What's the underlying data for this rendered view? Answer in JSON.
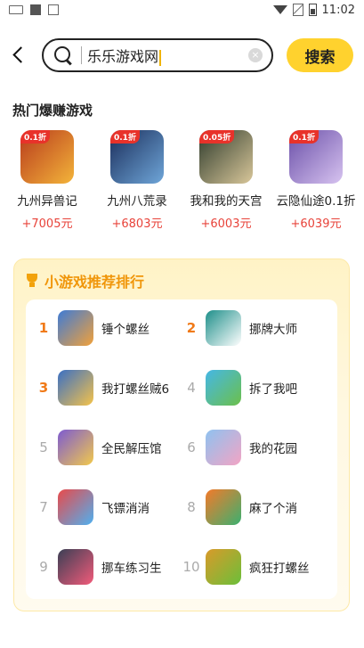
{
  "status_bar": {
    "time": "11:02"
  },
  "search": {
    "query": "乐乐游戏网",
    "clear_glyph": "×",
    "button_label": "搜索"
  },
  "hot": {
    "title": "热门爆赚游戏",
    "items": [
      {
        "name": "九州异兽记",
        "reward": "+7005元",
        "discount": "0.1折",
        "colors": [
          "#b83a1c",
          "#f3b43a"
        ]
      },
      {
        "name": "九州八荒录",
        "reward": "+6803元",
        "discount": "0.1折",
        "colors": [
          "#1a2d5a",
          "#6fa6d9"
        ]
      },
      {
        "name": "我和我的天宫",
        "reward": "+6003元",
        "discount": "0.05折",
        "colors": [
          "#2e3b2c",
          "#d9c79a"
        ]
      },
      {
        "name": "云隐仙途0.1折",
        "reward": "+6039元",
        "discount": "0.1折",
        "colors": [
          "#6a4fa8",
          "#d7c3f0"
        ]
      }
    ]
  },
  "ranking": {
    "title": "小游戏推荐排行",
    "items": [
      {
        "rank": "1",
        "name": "锤个螺丝",
        "colors": [
          "#3e7bd6",
          "#f2a13a"
        ]
      },
      {
        "rank": "2",
        "name": "挪牌大师",
        "colors": [
          "#1e8f8a",
          "#ffffff"
        ]
      },
      {
        "rank": "3",
        "name": "我打螺丝贼6",
        "colors": [
          "#3a6fc4",
          "#f5c34a"
        ]
      },
      {
        "rank": "4",
        "name": "拆了我吧",
        "colors": [
          "#45b7e6",
          "#6cc04a"
        ]
      },
      {
        "rank": "5",
        "name": "全民解压馆",
        "colors": [
          "#7d5bd1",
          "#f2c94c"
        ]
      },
      {
        "rank": "6",
        "name": "我的花园",
        "colors": [
          "#8fc2f0",
          "#f3a4c4"
        ]
      },
      {
        "rank": "7",
        "name": "飞镖消消",
        "colors": [
          "#e94a4a",
          "#4fb0f0"
        ]
      },
      {
        "rank": "8",
        "name": "麻了个消",
        "colors": [
          "#f47a2a",
          "#3bb070"
        ]
      },
      {
        "rank": "9",
        "name": "挪车练习生",
        "colors": [
          "#3a3f55",
          "#f25b7a"
        ]
      },
      {
        "rank": "10",
        "name": "疯狂打螺丝",
        "colors": [
          "#d99a2a",
          "#6bbf3a"
        ]
      }
    ]
  }
}
